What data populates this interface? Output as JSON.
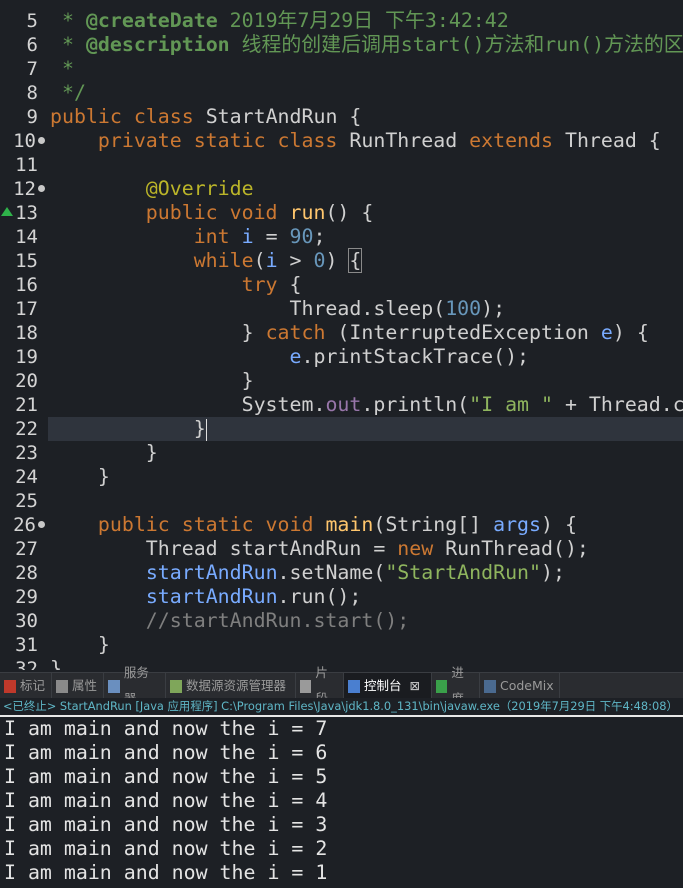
{
  "editor": {
    "current_line": 22,
    "lines": [
      {
        "num": "5",
        "tokens": [
          {
            "t": " * ",
            "c": "c"
          },
          {
            "t": "@createDate",
            "c": "cb"
          },
          {
            "t": " 2019年7月29日 下午3:42:42",
            "c": "c"
          }
        ]
      },
      {
        "num": "6",
        "tokens": [
          {
            "t": " * ",
            "c": "c"
          },
          {
            "t": "@description",
            "c": "cb"
          },
          {
            "t": " 线程的创建后调用start()方法和run()方法的区别",
            "c": "c"
          }
        ]
      },
      {
        "num": "7",
        "tokens": [
          {
            "t": " *",
            "c": "c"
          }
        ]
      },
      {
        "num": "8",
        "tokens": [
          {
            "t": " */",
            "c": "c"
          }
        ]
      },
      {
        "num": "9",
        "tokens": [
          {
            "t": "public class ",
            "c": "k"
          },
          {
            "t": "StartAndRun {",
            "c": "t"
          }
        ]
      },
      {
        "num": "10",
        "fold": true,
        "tokens": [
          {
            "t": "    private static class ",
            "c": "k"
          },
          {
            "t": "RunThread ",
            "c": "t"
          },
          {
            "t": "extends ",
            "c": "k"
          },
          {
            "t": "Thread {",
            "c": "t"
          }
        ]
      },
      {
        "num": "11",
        "tokens": []
      },
      {
        "num": "12",
        "fold": true,
        "tokens": [
          {
            "t": "        @Override",
            "c": "a"
          }
        ]
      },
      {
        "num": "13",
        "warn": true,
        "tokens": [
          {
            "t": "        public void ",
            "c": "k"
          },
          {
            "t": "run",
            "c": "m"
          },
          {
            "t": "() {",
            "c": "t"
          }
        ]
      },
      {
        "num": "14",
        "tokens": [
          {
            "t": "            int ",
            "c": "k"
          },
          {
            "t": "i",
            "c": "v"
          },
          {
            "t": " = ",
            "c": "t"
          },
          {
            "t": "90",
            "c": "n"
          },
          {
            "t": ";",
            "c": "t"
          }
        ]
      },
      {
        "num": "15",
        "tokens": [
          {
            "t": "            while",
            "c": "k"
          },
          {
            "t": "(",
            "c": "t"
          },
          {
            "t": "i",
            "c": "v"
          },
          {
            "t": " > ",
            "c": "t"
          },
          {
            "t": "0",
            "c": "n"
          },
          {
            "t": ") ",
            "c": "t"
          },
          {
            "t": "{",
            "c": "t br"
          }
        ]
      },
      {
        "num": "16",
        "tokens": [
          {
            "t": "                try ",
            "c": "k"
          },
          {
            "t": "{",
            "c": "t"
          }
        ]
      },
      {
        "num": "17",
        "tokens": [
          {
            "t": "                    Thread.sleep(",
            "c": "t"
          },
          {
            "t": "100",
            "c": "n"
          },
          {
            "t": ");",
            "c": "t"
          }
        ]
      },
      {
        "num": "18",
        "tokens": [
          {
            "t": "                } ",
            "c": "t"
          },
          {
            "t": "catch ",
            "c": "k"
          },
          {
            "t": "(InterruptedException ",
            "c": "t"
          },
          {
            "t": "e",
            "c": "v"
          },
          {
            "t": ") {",
            "c": "t"
          }
        ]
      },
      {
        "num": "19",
        "tokens": [
          {
            "t": "                    ",
            "c": "t"
          },
          {
            "t": "e",
            "c": "v"
          },
          {
            "t": ".printStackTrace();",
            "c": "t"
          }
        ]
      },
      {
        "num": "20",
        "tokens": [
          {
            "t": "                }",
            "c": "t"
          }
        ]
      },
      {
        "num": "21",
        "tokens": [
          {
            "t": "                System.",
            "c": "t"
          },
          {
            "t": "out",
            "c": "f"
          },
          {
            "t": ".println(",
            "c": "t"
          },
          {
            "t": "\"I am \"",
            "c": "s"
          },
          {
            "t": " + Thread.c",
            "c": "t"
          }
        ]
      },
      {
        "num": "22",
        "caret": true,
        "tokens": [
          {
            "t": "            }",
            "c": "t"
          }
        ]
      },
      {
        "num": "23",
        "tokens": [
          {
            "t": "        }",
            "c": "t"
          }
        ]
      },
      {
        "num": "24",
        "tokens": [
          {
            "t": "    }",
            "c": "t"
          }
        ]
      },
      {
        "num": "25",
        "tokens": []
      },
      {
        "num": "26",
        "fold": true,
        "tokens": [
          {
            "t": "    public static void ",
            "c": "k"
          },
          {
            "t": "main",
            "c": "m"
          },
          {
            "t": "(String[] ",
            "c": "t"
          },
          {
            "t": "args",
            "c": "v"
          },
          {
            "t": ") {",
            "c": "t"
          }
        ]
      },
      {
        "num": "27",
        "tokens": [
          {
            "t": "        Thread startAndRun = ",
            "c": "t"
          },
          {
            "t": "new ",
            "c": "k"
          },
          {
            "t": "RunThread();",
            "c": "t"
          }
        ]
      },
      {
        "num": "28",
        "tokens": [
          {
            "t": "        ",
            "c": "t"
          },
          {
            "t": "startAndRun",
            "c": "v"
          },
          {
            "t": ".setName(",
            "c": "t"
          },
          {
            "t": "\"StartAndRun\"",
            "c": "s"
          },
          {
            "t": ");",
            "c": "t"
          }
        ]
      },
      {
        "num": "29",
        "tokens": [
          {
            "t": "        ",
            "c": "t"
          },
          {
            "t": "startAndRun",
            "c": "v"
          },
          {
            "t": ".run();",
            "c": "t"
          }
        ]
      },
      {
        "num": "30",
        "tokens": [
          {
            "t": "        //startAndRun.start();",
            "c": "g"
          }
        ]
      },
      {
        "num": "31",
        "tokens": [
          {
            "t": "    }",
            "c": "t"
          }
        ]
      },
      {
        "num": "32",
        "tokens": [
          {
            "t": "}",
            "c": "t"
          }
        ]
      }
    ]
  },
  "panel": {
    "tabs": [
      {
        "label": "标记",
        "icon": "markers-icon",
        "color": "#c0392b"
      },
      {
        "label": "属性",
        "icon": "properties-icon",
        "color": "#8a8a8a"
      },
      {
        "label": "服务器",
        "icon": "servers-icon",
        "color": "#6a8fbf"
      },
      {
        "label": "数据源资源管理器",
        "icon": "data-source-icon",
        "color": "#7fa65a"
      },
      {
        "label": "片段",
        "icon": "snippets-icon",
        "color": "#9a9a9a"
      },
      {
        "label": "控制台",
        "icon": "console-icon",
        "color": "#4a7fd0",
        "active": true
      },
      {
        "label": "进度",
        "icon": "progress-icon",
        "color": "#3aa04a"
      },
      {
        "label": "CodeMix",
        "icon": "codemix-icon",
        "color": "#4a6a90"
      }
    ],
    "close_glyph": "⊠",
    "status": "<已终止> StartAndRun [Java 应用程序] C:\\Program Files\\Java\\jdk1.8.0_131\\bin\\javaw.exe（2019年7月29日 下午4:48:08）"
  },
  "console": {
    "lines": [
      "I am main and now the i = 7",
      "I am main and now the i = 6",
      "I am main and now the i = 5",
      "I am main and now the i = 4",
      "I am main and now the i = 3",
      "I am main and now the i = 2",
      "I am main and now the i = 1"
    ]
  }
}
